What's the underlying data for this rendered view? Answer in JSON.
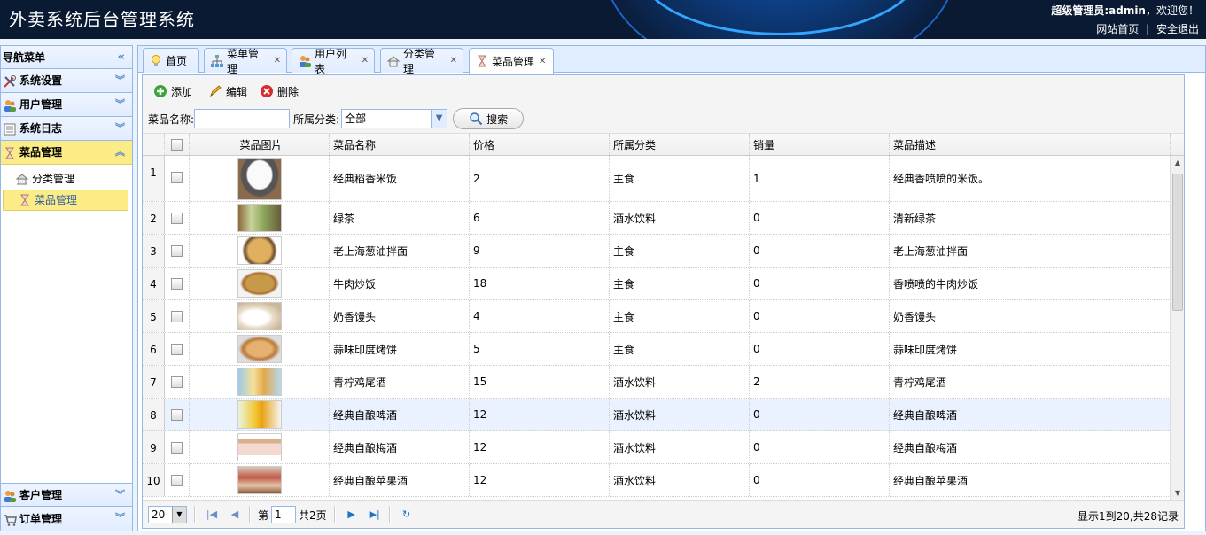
{
  "header": {
    "title": "外卖系统后台管理系统",
    "welcome_prefix": "超级管理员:admin",
    "welcome_suffix": "，欢迎您！",
    "home_link": "网站首页",
    "separator": "|",
    "logout_link": "安全退出"
  },
  "sidebar": {
    "title": "导航菜单",
    "collapse_icon": "double-chevron-left-icon",
    "groups": [
      {
        "label": "系统设置",
        "icon": "tools-icon",
        "expanded": false
      },
      {
        "label": "用户管理",
        "icon": "users-icon",
        "expanded": false
      },
      {
        "label": "系统日志",
        "icon": "log-icon",
        "expanded": false
      },
      {
        "label": "菜品管理",
        "icon": "hourglass-icon",
        "expanded": true
      }
    ],
    "sub_items": [
      {
        "label": "分类管理",
        "icon": "category-icon",
        "selected": false
      },
      {
        "label": "菜品管理",
        "icon": "hourglass-icon",
        "selected": true
      }
    ],
    "bottom_groups": [
      {
        "label": "客户管理",
        "icon": "customer-icon"
      },
      {
        "label": "订单管理",
        "icon": "cart-icon"
      }
    ]
  },
  "tabs": [
    {
      "label": "首页",
      "icon": "bulb-icon",
      "closable": false,
      "active": false
    },
    {
      "label": "菜单管理",
      "icon": "tree-icon",
      "closable": true,
      "active": false
    },
    {
      "label": "用户列表",
      "icon": "users-icon",
      "closable": true,
      "active": false
    },
    {
      "label": "分类管理",
      "icon": "category-icon",
      "closable": true,
      "active": false
    },
    {
      "label": "菜品管理",
      "icon": "hourglass-icon",
      "closable": true,
      "active": true
    }
  ],
  "toolbar": {
    "add_label": "添加",
    "edit_label": "编辑",
    "delete_label": "删除"
  },
  "search": {
    "name_label": "菜品名称:",
    "name_value": "",
    "category_label": "所属分类:",
    "category_value": "全部",
    "search_label": "搜索"
  },
  "table": {
    "columns": [
      "菜品图片",
      "菜品名称",
      "价格",
      "所属分类",
      "销量",
      "菜品描述"
    ],
    "rows": [
      {
        "num": "1",
        "name": "经典稻香米饭",
        "price": "2",
        "category": "主食",
        "sales": "1",
        "desc": "经典香喷喷的米饭。",
        "img": "rice"
      },
      {
        "num": "2",
        "name": "绿茶",
        "price": "6",
        "category": "酒水饮料",
        "sales": "0",
        "desc": "清新绿茶",
        "img": "tea"
      },
      {
        "num": "3",
        "name": "老上海葱油拌面",
        "price": "9",
        "category": "主食",
        "sales": "0",
        "desc": "老上海葱油拌面",
        "img": "noodle"
      },
      {
        "num": "4",
        "name": "牛肉炒饭",
        "price": "18",
        "category": "主食",
        "sales": "0",
        "desc": "香喷喷的牛肉炒饭",
        "img": "friedrice"
      },
      {
        "num": "5",
        "name": "奶香馒头",
        "price": "4",
        "category": "主食",
        "sales": "0",
        "desc": "奶香馒头",
        "img": "bun"
      },
      {
        "num": "6",
        "name": "蒜味印度烤饼",
        "price": "5",
        "category": "主食",
        "sales": "0",
        "desc": "蒜味印度烤饼",
        "img": "naan"
      },
      {
        "num": "7",
        "name": "青柠鸡尾酒",
        "price": "15",
        "category": "酒水饮料",
        "sales": "2",
        "desc": "青柠鸡尾酒",
        "img": "cocktail"
      },
      {
        "num": "8",
        "name": "经典自酿啤酒",
        "price": "12",
        "category": "酒水饮料",
        "sales": "0",
        "desc": "经典自酿啤酒",
        "img": "beer"
      },
      {
        "num": "9",
        "name": "经典自酿梅酒",
        "price": "12",
        "category": "酒水饮料",
        "sales": "0",
        "desc": "经典自酿梅酒",
        "img": "plum"
      },
      {
        "num": "10",
        "name": "经典自酿苹果酒",
        "price": "12",
        "category": "酒水饮料",
        "sales": "0",
        "desc": "经典自酿苹果酒",
        "img": "apple"
      }
    ]
  },
  "pager": {
    "page_size": "20",
    "page_prefix": "第",
    "page_value": "1",
    "page_total": "共2页",
    "info": "显示1到20,共28记录"
  },
  "colors": {
    "header_bg": "#0b1a33",
    "panel_border": "#95b8e7",
    "selected_bg": "#fbec88"
  }
}
